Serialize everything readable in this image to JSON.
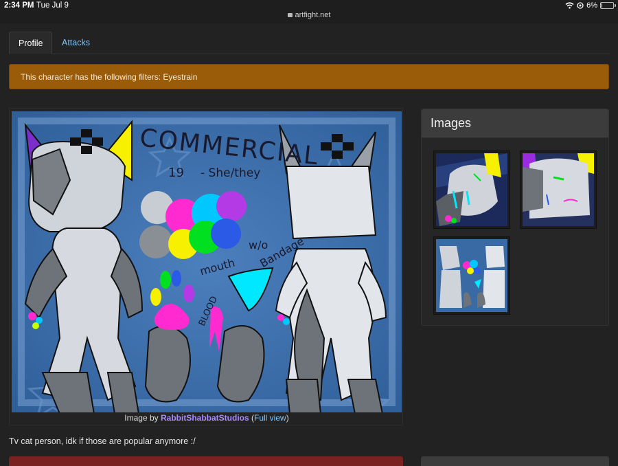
{
  "status_bar": {
    "time": "2:34 PM",
    "date": "Tue Jul 9",
    "url": "artfight.net",
    "battery": "6%",
    "battery_level": 0.06
  },
  "tabs": [
    {
      "label": "Profile",
      "active": true
    },
    {
      "label": "Attacks",
      "active": false
    }
  ],
  "filter_alert": {
    "text": "This character has the following filters: Eyestrain"
  },
  "main_image": {
    "caption_prefix": "Image by ",
    "artist": "RabbitShabbatStudios",
    "open_paren": " (",
    "full_view_label": "Full view",
    "close_paren": ")"
  },
  "artwork_text": {
    "title": "COMMERCIAL",
    "age": "19",
    "pronouns": "- She/they",
    "note_wo": "w/o",
    "note_bandage": "Bandage",
    "note_mouth": "mouth",
    "note_blood": "BLOOD"
  },
  "description": "Tv cat person, idk if those are popular anymore :/",
  "images_panel": {
    "title": "Images",
    "thumbnails": [
      {
        "name": "thumbnail-1"
      },
      {
        "name": "thumbnail-2"
      },
      {
        "name": "thumbnail-3"
      }
    ]
  },
  "colors": {
    "alert": "#9a5c08",
    "link": "#7ec8ff",
    "artist_link": "#a98bff",
    "background": "#222222"
  }
}
